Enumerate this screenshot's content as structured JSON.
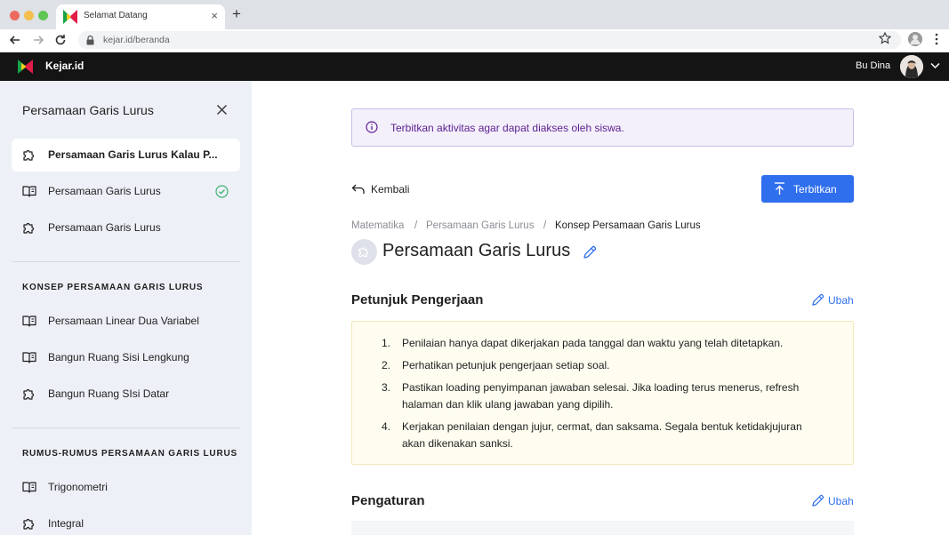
{
  "browser": {
    "tab_title": "Selamat Datang",
    "tab_close": "×",
    "new_tab": "+",
    "url": "kejar.id/beranda"
  },
  "app": {
    "name": "Kejar.id",
    "user_name": "Bu Dina"
  },
  "sidebar": {
    "title": "Persamaan Garis Lurus",
    "top_items": [
      {
        "label": "Persamaan Garis Lurus Kalau P...",
        "icon": "puzzle-icon",
        "active": true
      },
      {
        "label": "Persamaan Garis Lurus",
        "icon": "book-icon",
        "completed": true
      },
      {
        "label": "Persamaan Garis Lurus",
        "icon": "puzzle-icon"
      }
    ],
    "sections": [
      {
        "title": "KONSEP PERSAMAAN GARIS LURUS",
        "items": [
          {
            "label": "Persamaan Linear Dua Variabel",
            "icon": "book-icon"
          },
          {
            "label": "Bangun Ruang Sisi Lengkung",
            "icon": "book-icon"
          },
          {
            "label": "Bangun Ruang SIsi Datar",
            "icon": "puzzle-icon"
          }
        ]
      },
      {
        "title": "RUMUS-RUMUS PERSAMAAN GARIS LURUS",
        "items": [
          {
            "label": "Trigonometri",
            "icon": "book-icon"
          },
          {
            "label": "Integral",
            "icon": "puzzle-icon"
          }
        ]
      }
    ]
  },
  "main": {
    "banner_text": "Terbitkan aktivitas agar dapat diakses oleh siswa.",
    "back_label": "Kembali",
    "publish_label": "Terbitkan",
    "breadcrumb": [
      "Matematika",
      "/",
      "Persamaan Garis Lurus",
      "/",
      "Konsep Persamaan Garis Lurus"
    ],
    "title": "Persamaan Garis Lurus",
    "instructions": {
      "title": "Petunjuk Pengerjaan",
      "edit_label": "Ubah",
      "items": [
        {
          "num": "1.",
          "text": "Penilaian hanya dapat dikerjakan pada tanggal dan waktu yang telah ditetapkan."
        },
        {
          "num": "2.",
          "text": "Perhatikan petunjuk pengerjaan setiap soal."
        },
        {
          "num": "3.",
          "text": "Pastikan loading penyimpanan jawaban selesai. Jika loading terus menerus, refresh halaman dan klik ulang jawaban yang dipilih."
        },
        {
          "num": "4.",
          "text": "Kerjakan penilaian dengan jujur, cermat, dan saksama. Segala bentuk ketidakjujuran akan dikenakan sanksi."
        }
      ]
    },
    "settings": {
      "title": "Pengaturan",
      "edit_label": "Ubah"
    }
  },
  "colors": {
    "accent": "#2f6fed",
    "banner_text": "#5b1e8f",
    "success": "#3cb371",
    "appbar": "#141414",
    "sidebar_bg": "#eef0f7"
  }
}
